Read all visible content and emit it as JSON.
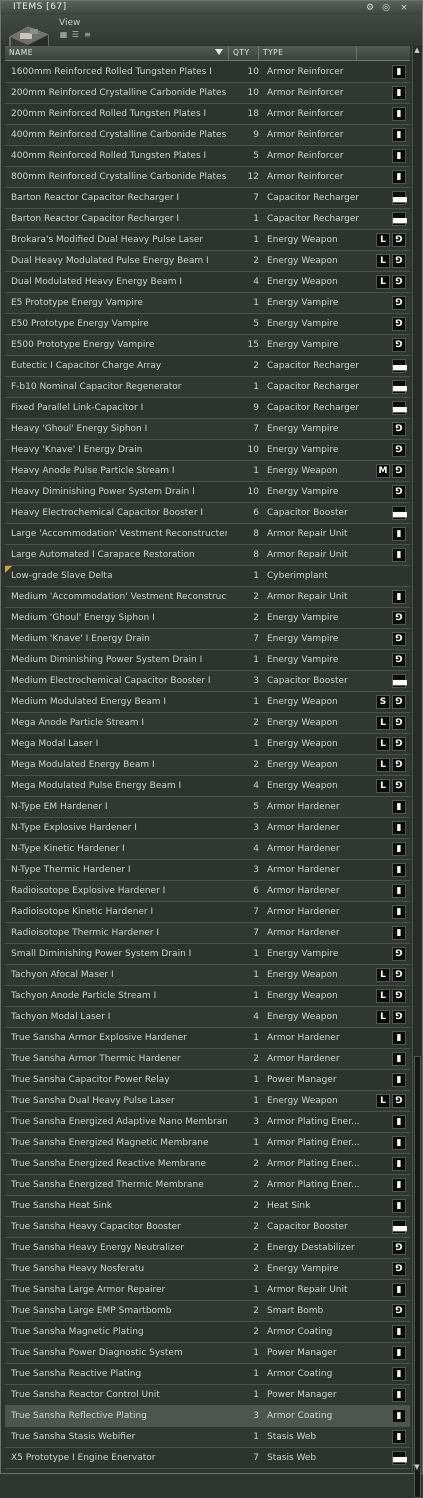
{
  "window": {
    "title": "ITEMS [67]",
    "view_label": "View",
    "title_buttons": [
      "⚙",
      "◎",
      "×"
    ],
    "view_mode_icons": [
      "icons-view-icon",
      "details-view-icon",
      "list-view-icon"
    ]
  },
  "columns": {
    "name": "NAME",
    "qty": "QTY",
    "type": "TYPE"
  },
  "items": [
    {
      "name": "1600mm Reinforced Rolled Tungsten Plates I",
      "qty": "10",
      "type": "Armor Reinforcer",
      "badges": [
        "▮"
      ]
    },
    {
      "name": "200mm Reinforced Crystalline Carbonide Plates I",
      "qty": "10",
      "type": "Armor Reinforcer",
      "badges": [
        "▮"
      ]
    },
    {
      "name": "200mm Reinforced Rolled Tungsten Plates I",
      "qty": "18",
      "type": "Armor Reinforcer",
      "badges": [
        "▮"
      ]
    },
    {
      "name": "400mm Reinforced Crystalline Carbonide Plates I",
      "qty": "9",
      "type": "Armor Reinforcer",
      "badges": [
        "▮"
      ]
    },
    {
      "name": "400mm Reinforced Rolled Tungsten Plates I",
      "qty": "5",
      "type": "Armor Reinforcer",
      "badges": [
        "▮"
      ]
    },
    {
      "name": "800mm Reinforced Crystalline Carbonide Plates I",
      "qty": "12",
      "type": "Armor Reinforcer",
      "badges": [
        "▮"
      ]
    },
    {
      "name": "Barton Reactor Capacitor Recharger I",
      "qty": "7",
      "type": "Capacitor Recharger",
      "badges": [
        "▄▄"
      ]
    },
    {
      "name": "Barton Reactor Capacitor Recharger I",
      "qty": "1",
      "type": "Capacitor Recharger",
      "badges": [
        "▄▄"
      ]
    },
    {
      "name": "Brokara's Modified Dual Heavy Pulse Laser",
      "qty": "1",
      "type": "Energy Weapon",
      "badges": [
        "⅁",
        "L"
      ]
    },
    {
      "name": "Dual Heavy Modulated Pulse Energy Beam I",
      "qty": "2",
      "type": "Energy Weapon",
      "badges": [
        "⅁",
        "L"
      ]
    },
    {
      "name": "Dual Modulated Heavy Energy Beam I",
      "qty": "4",
      "type": "Energy Weapon",
      "badges": [
        "⅁",
        "L"
      ]
    },
    {
      "name": "E5 Prototype Energy Vampire",
      "qty": "1",
      "type": "Energy Vampire",
      "badges": [
        "⅁"
      ]
    },
    {
      "name": "E50 Prototype Energy Vampire",
      "qty": "5",
      "type": "Energy Vampire",
      "badges": [
        "⅁"
      ]
    },
    {
      "name": "E500 Prototype Energy Vampire",
      "qty": "15",
      "type": "Energy Vampire",
      "badges": [
        "⅁"
      ]
    },
    {
      "name": "Eutectic I Capacitor Charge Array",
      "qty": "2",
      "type": "Capacitor Recharger",
      "badges": [
        "▄▄"
      ]
    },
    {
      "name": "F-b10 Nominal Capacitor Regenerator",
      "qty": "1",
      "type": "Capacitor Recharger",
      "badges": [
        "▄▄"
      ]
    },
    {
      "name": "Fixed Parallel Link-Capacitor I",
      "qty": "9",
      "type": "Capacitor Recharger",
      "badges": [
        "▄▄"
      ]
    },
    {
      "name": "Heavy 'Ghoul' Energy Siphon I",
      "qty": "7",
      "type": "Energy Vampire",
      "badges": [
        "⅁"
      ]
    },
    {
      "name": "Heavy 'Knave' I Energy Drain",
      "qty": "10",
      "type": "Energy Vampire",
      "badges": [
        "⅁"
      ]
    },
    {
      "name": "Heavy Anode Pulse Particle Stream I",
      "qty": "1",
      "type": "Energy Weapon",
      "badges": [
        "⅁",
        "M"
      ]
    },
    {
      "name": "Heavy Diminishing Power System Drain I",
      "qty": "10",
      "type": "Energy Vampire",
      "badges": [
        "⅁"
      ]
    },
    {
      "name": "Heavy Electrochemical Capacitor Booster I",
      "qty": "6",
      "type": "Capacitor Booster",
      "badges": [
        "▄▄"
      ]
    },
    {
      "name": "Large 'Accommodation' Vestment Reconstructer I",
      "qty": "8",
      "type": "Armor Repair Unit",
      "badges": [
        "▮"
      ]
    },
    {
      "name": "Large Automated I Carapace Restoration",
      "qty": "8",
      "type": "Armor Repair Unit",
      "badges": [
        "▮"
      ]
    },
    {
      "name": "Low-grade Slave Delta",
      "qty": "1",
      "type": "Cyberimplant",
      "badges": [],
      "implant": true
    },
    {
      "name": "Medium 'Accommodation' Vestment Reconstructer...",
      "qty": "2",
      "type": "Armor Repair Unit",
      "badges": [
        "▮"
      ]
    },
    {
      "name": "Medium 'Ghoul' Energy Siphon I",
      "qty": "2",
      "type": "Energy Vampire",
      "badges": [
        "⅁"
      ]
    },
    {
      "name": "Medium 'Knave' I Energy Drain",
      "qty": "7",
      "type": "Energy Vampire",
      "badges": [
        "⅁"
      ]
    },
    {
      "name": "Medium Diminishing Power System Drain I",
      "qty": "1",
      "type": "Energy Vampire",
      "badges": [
        "⅁"
      ]
    },
    {
      "name": "Medium Electrochemical Capacitor Booster I",
      "qty": "3",
      "type": "Capacitor Booster",
      "badges": [
        "▄▄"
      ]
    },
    {
      "name": "Medium Modulated Energy Beam I",
      "qty": "1",
      "type": "Energy Weapon",
      "badges": [
        "⅁",
        "S"
      ]
    },
    {
      "name": "Mega Anode Particle Stream I",
      "qty": "2",
      "type": "Energy Weapon",
      "badges": [
        "⅁",
        "L"
      ]
    },
    {
      "name": "Mega Modal Laser I",
      "qty": "1",
      "type": "Energy Weapon",
      "badges": [
        "⅁",
        "L"
      ]
    },
    {
      "name": "Mega Modulated Energy Beam I",
      "qty": "2",
      "type": "Energy Weapon",
      "badges": [
        "⅁",
        "L"
      ]
    },
    {
      "name": "Mega Modulated Pulse Energy Beam I",
      "qty": "4",
      "type": "Energy Weapon",
      "badges": [
        "⅁",
        "L"
      ]
    },
    {
      "name": "N-Type EM Hardener I",
      "qty": "5",
      "type": "Armor Hardener",
      "badges": [
        "▮"
      ]
    },
    {
      "name": "N-Type Explosive Hardener I",
      "qty": "3",
      "type": "Armor Hardener",
      "badges": [
        "▮"
      ]
    },
    {
      "name": "N-Type Kinetic Hardener I",
      "qty": "4",
      "type": "Armor Hardener",
      "badges": [
        "▮"
      ]
    },
    {
      "name": "N-Type Thermic Hardener I",
      "qty": "3",
      "type": "Armor Hardener",
      "badges": [
        "▮"
      ]
    },
    {
      "name": "Radioisotope Explosive Hardener I",
      "qty": "6",
      "type": "Armor Hardener",
      "badges": [
        "▮"
      ]
    },
    {
      "name": "Radioisotope Kinetic Hardener I",
      "qty": "7",
      "type": "Armor Hardener",
      "badges": [
        "▮"
      ]
    },
    {
      "name": "Radioisotope Thermic Hardener I",
      "qty": "7",
      "type": "Armor Hardener",
      "badges": [
        "▮"
      ]
    },
    {
      "name": "Small Diminishing Power System Drain I",
      "qty": "1",
      "type": "Energy Vampire",
      "badges": [
        "⅁"
      ]
    },
    {
      "name": "Tachyon Afocal Maser I",
      "qty": "1",
      "type": "Energy Weapon",
      "badges": [
        "⅁",
        "L"
      ]
    },
    {
      "name": "Tachyon Anode Particle Stream I",
      "qty": "1",
      "type": "Energy Weapon",
      "badges": [
        "⅁",
        "L"
      ]
    },
    {
      "name": "Tachyon Modal Laser I",
      "qty": "4",
      "type": "Energy Weapon",
      "badges": [
        "⅁",
        "L"
      ]
    },
    {
      "name": "True Sansha Armor Explosive Hardener",
      "qty": "1",
      "type": "Armor Hardener",
      "badges": [
        "▮"
      ]
    },
    {
      "name": "True Sansha Armor Thermic Hardener",
      "qty": "2",
      "type": "Armor Hardener",
      "badges": [
        "▮"
      ]
    },
    {
      "name": "True Sansha Capacitor Power Relay",
      "qty": "1",
      "type": "Power Manager",
      "badges": [
        "▮"
      ]
    },
    {
      "name": "True Sansha Dual Heavy Pulse Laser",
      "qty": "1",
      "type": "Energy Weapon",
      "badges": [
        "⅁",
        "L"
      ]
    },
    {
      "name": "True Sansha Energized Adaptive Nano Membrane",
      "qty": "3",
      "type": "Armor Plating Ener...",
      "badges": [
        "▮"
      ]
    },
    {
      "name": "True Sansha Energized Magnetic Membrane",
      "qty": "1",
      "type": "Armor Plating Ener...",
      "badges": [
        "▮"
      ]
    },
    {
      "name": "True Sansha Energized Reactive Membrane",
      "qty": "2",
      "type": "Armor Plating Ener...",
      "badges": [
        "▮"
      ]
    },
    {
      "name": "True Sansha Energized Thermic Membrane",
      "qty": "2",
      "type": "Armor Plating Ener...",
      "badges": [
        "▮"
      ]
    },
    {
      "name": "True Sansha Heat Sink",
      "qty": "2",
      "type": "Heat Sink",
      "badges": [
        "▮"
      ]
    },
    {
      "name": "True Sansha Heavy Capacitor Booster",
      "qty": "2",
      "type": "Capacitor Booster",
      "badges": [
        "▄▄"
      ]
    },
    {
      "name": "True Sansha Heavy Energy Neutralizer",
      "qty": "2",
      "type": "Energy Destabilizer",
      "badges": [
        "⅁"
      ]
    },
    {
      "name": "True Sansha Heavy Nosferatu",
      "qty": "2",
      "type": "Energy Vampire",
      "badges": [
        "⅁"
      ]
    },
    {
      "name": "True Sansha Large Armor Repairer",
      "qty": "1",
      "type": "Armor Repair Unit",
      "badges": [
        "▮"
      ]
    },
    {
      "name": "True Sansha Large EMP Smartbomb",
      "qty": "2",
      "type": "Smart Bomb",
      "badges": [
        "⅁"
      ]
    },
    {
      "name": "True Sansha Magnetic Plating",
      "qty": "2",
      "type": "Armor Coating",
      "badges": [
        "▮"
      ]
    },
    {
      "name": "True Sansha Power Diagnostic System",
      "qty": "1",
      "type": "Power Manager",
      "badges": [
        "▮"
      ]
    },
    {
      "name": "True Sansha Reactive Plating",
      "qty": "1",
      "type": "Armor Coating",
      "badges": [
        "▮"
      ]
    },
    {
      "name": "True Sansha Reactor Control Unit",
      "qty": "1",
      "type": "Power Manager",
      "badges": [
        "▮"
      ]
    },
    {
      "name": "True Sansha Reflective Plating",
      "qty": "3",
      "type": "Armor Coating",
      "badges": [
        "▮"
      ],
      "selected": true
    },
    {
      "name": "True Sansha Stasis Webifier",
      "qty": "1",
      "type": "Stasis Web",
      "badges": [
        "▮"
      ]
    },
    {
      "name": "X5 Prototype I Engine Enervator",
      "qty": "7",
      "type": "Stasis Web",
      "badges": [
        "▄▄"
      ]
    }
  ]
}
